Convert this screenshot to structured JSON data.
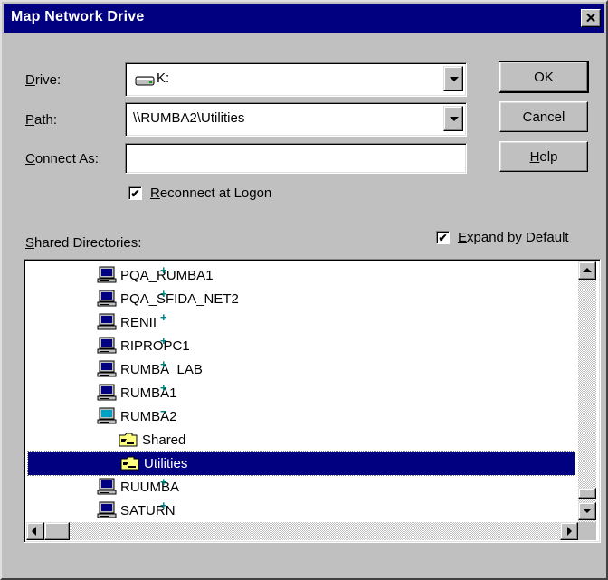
{
  "window": {
    "title": "Map Network Drive",
    "close_glyph": "✕"
  },
  "drive": {
    "label_key": "D",
    "label_rest": "rive:",
    "value": "K:",
    "icon": "drive-icon"
  },
  "path": {
    "label_key": "P",
    "label_rest": "ath:",
    "value": "\\\\RUMBA2\\Utilities"
  },
  "connect_as": {
    "label_key": "C",
    "label_rest": "onnect As:",
    "value": ""
  },
  "reconnect": {
    "label_key": "R",
    "label_rest": "econnect at Logon",
    "checked": true,
    "check_glyph": "✔"
  },
  "shared": {
    "label_key": "S",
    "label_rest": "hared Directories:"
  },
  "expand_default": {
    "label_key": "E",
    "label_rest": "xpand by Default",
    "checked": true,
    "check_glyph": "✔"
  },
  "buttons": {
    "ok": "OK",
    "cancel": "Cancel",
    "help_key": "H",
    "help_rest": "elp"
  },
  "tree": {
    "plus": "+",
    "minus": "−",
    "items": [
      {
        "label": "PQA_RUMBA1",
        "kind": "computer",
        "expander": "+"
      },
      {
        "label": "PQA_SFIDA_NET2",
        "kind": "computer",
        "expander": "+"
      },
      {
        "label": "RENII",
        "kind": "computer",
        "expander": "+"
      },
      {
        "label": "RIPROPC1",
        "kind": "computer",
        "expander": "+"
      },
      {
        "label": "RUMBA_LAB",
        "kind": "computer",
        "expander": "+"
      },
      {
        "label": "RUMBA1",
        "kind": "computer",
        "expander": "+"
      },
      {
        "label": "RUMBA2",
        "kind": "computer",
        "expander": "−"
      },
      {
        "label": "Shared",
        "kind": "folder",
        "expander": ""
      },
      {
        "label": "Utilities",
        "kind": "folder",
        "expander": "",
        "selected": true
      },
      {
        "label": "RUUMBA",
        "kind": "computer",
        "expander": "+"
      },
      {
        "label": "SATURN",
        "kind": "computer",
        "expander": "+"
      }
    ]
  },
  "colors": {
    "dialog_bg": "#c0c0c0",
    "titlebar": "#000080",
    "selection": "#000080"
  }
}
